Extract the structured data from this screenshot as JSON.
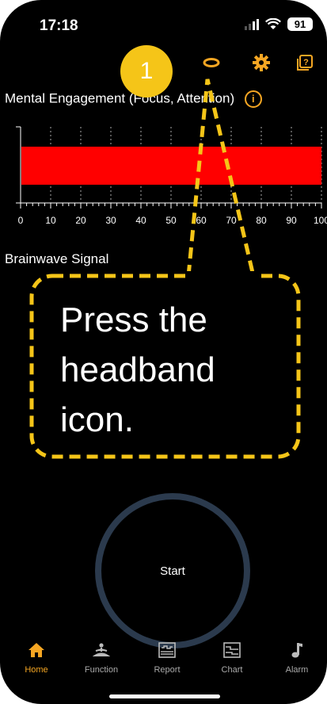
{
  "status": {
    "time": "17:18",
    "battery": "91"
  },
  "topbar": {
    "icons": [
      "headband-icon",
      "gear-icon",
      "help-book-icon"
    ]
  },
  "engagement": {
    "title": "Mental Engagement (Focus, Attention)"
  },
  "chart_data": {
    "type": "bar",
    "orientation": "horizontal",
    "categories": [
      ""
    ],
    "values": [
      100
    ],
    "bar_color": "#ff0000",
    "xlim": [
      0,
      100
    ],
    "x_ticks": [
      "0",
      "10",
      "20",
      "30",
      "40",
      "50",
      "60",
      "70",
      "80",
      "90",
      "100"
    ],
    "grid": true
  },
  "brainwave": {
    "title": "Brainwave Signal"
  },
  "callout": {
    "step": "1",
    "text": "Press the headband icon."
  },
  "start": {
    "label": "Start"
  },
  "tabs": [
    {
      "label": "Home",
      "icon": "home-icon",
      "active": true
    },
    {
      "label": "Function",
      "icon": "meditation-icon",
      "active": false
    },
    {
      "label": "Report",
      "icon": "report-icon",
      "active": false
    },
    {
      "label": "Chart",
      "icon": "chart-icon",
      "active": false
    },
    {
      "label": "Alarm",
      "icon": "music-note-icon",
      "active": false
    }
  ],
  "colors": {
    "accent": "#f5a623",
    "callout": "#f5c518",
    "bar": "#ff0000",
    "ring": "#2b3a4d"
  }
}
